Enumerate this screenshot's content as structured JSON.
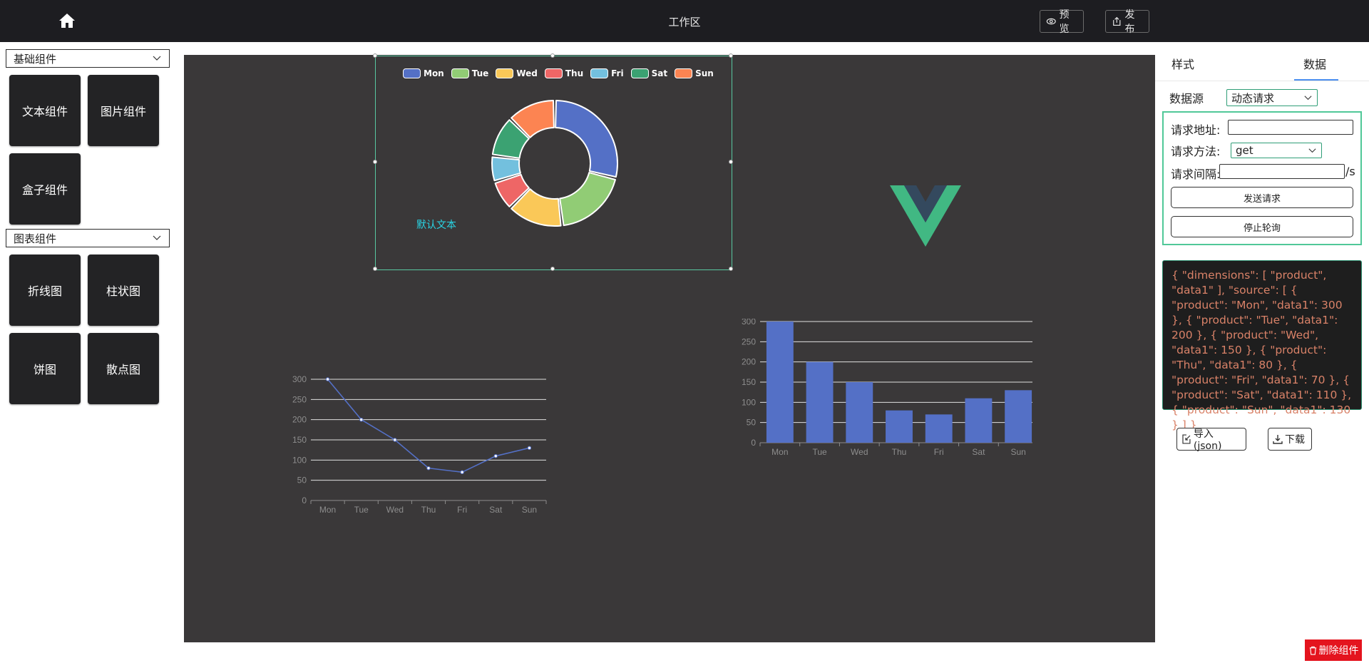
{
  "header": {
    "title": "工作区",
    "home_icon": "home-icon",
    "preview_label": "预览",
    "publish_label": "发布"
  },
  "left_panel": {
    "basic_category": "基础组件",
    "basic_components": [
      "文本组件",
      "图片组件",
      "盒子组件"
    ],
    "chart_category": "图表组件",
    "chart_components": [
      "折线图",
      "柱状图",
      "饼图",
      "散点图"
    ]
  },
  "canvas": {
    "background": "#3a3839",
    "default_text": "默认文本",
    "text_color": "#29d6e6",
    "selection_color": "#58c8a0"
  },
  "chart_data": [
    {
      "type": "pie",
      "variant": "donut",
      "categories": [
        "Mon",
        "Tue",
        "Wed",
        "Thu",
        "Fri",
        "Sat",
        "Sun"
      ],
      "values": [
        300,
        200,
        150,
        80,
        70,
        110,
        130
      ],
      "colors": [
        "#5470c6",
        "#91cc75",
        "#fac858",
        "#ee6666",
        "#73c0de",
        "#3ba272",
        "#fc8452"
      ],
      "legend": "top"
    },
    {
      "type": "line",
      "categories": [
        "Mon",
        "Tue",
        "Wed",
        "Thu",
        "Fri",
        "Sat",
        "Sun"
      ],
      "values": [
        300,
        200,
        150,
        80,
        70,
        110,
        130
      ],
      "yticks": [
        0,
        50,
        100,
        150,
        200,
        250,
        300
      ],
      "ylim": [
        0,
        300
      ],
      "color": "#5470c6",
      "grid": true
    },
    {
      "type": "bar",
      "categories": [
        "Mon",
        "Tue",
        "Wed",
        "Thu",
        "Fri",
        "Sat",
        "Sun"
      ],
      "values": [
        300,
        200,
        150,
        80,
        70,
        110,
        130
      ],
      "yticks": [
        0,
        50,
        100,
        150,
        200,
        250,
        300
      ],
      "ylim": [
        0,
        300
      ],
      "color": "#5470c6",
      "grid": true
    }
  ],
  "right_panel": {
    "tabs": [
      "样式",
      "数据"
    ],
    "active_tab": "数据",
    "datasource_label": "数据源",
    "datasource_value": "动态请求",
    "url_label": "请求地址:",
    "url_value": "",
    "method_label": "请求方法:",
    "method_value": "get",
    "interval_label": "请求间隔:",
    "interval_value": "",
    "interval_unit": "/s",
    "send_label": "发送请求",
    "stop_label": "停止轮询",
    "json_text": "{ \"dimensions\": [ \"product\", \"data1\" ], \"source\": [ { \"product\": \"Mon\", \"data1\": 300 }, { \"product\": \"Tue\", \"data1\": 200 }, { \"product\": \"Wed\", \"data1\": 150 }, { \"product\": \"Thu\", \"data1\": 80 }, { \"product\": \"Fri\", \"data1\": 70 }, { \"product\": \"Sat\", \"data1\": 110 }, { \"product\": \"Sun\", \"data1\": 130 } ] }",
    "import_label": "导入(json)",
    "download_label": "下载"
  },
  "delete_label": "删除组件"
}
